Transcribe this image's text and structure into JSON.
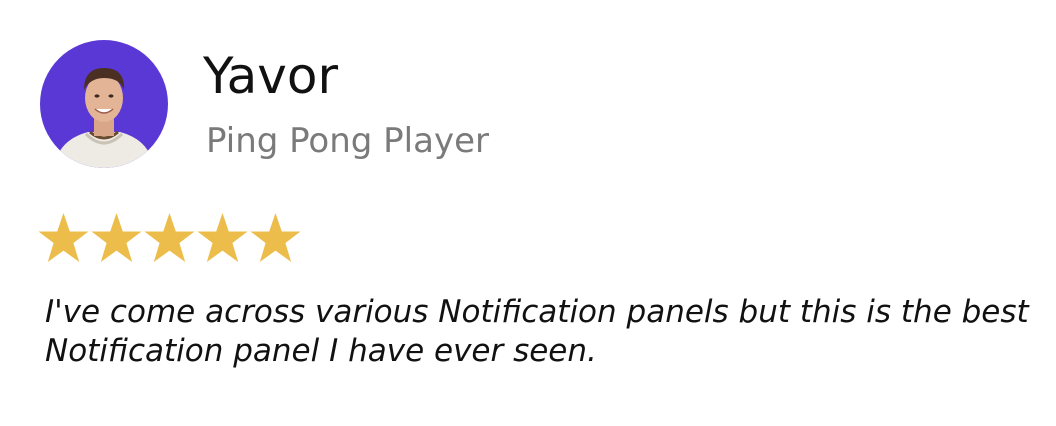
{
  "review_card": {
    "reviewer": {
      "name": "Yavor",
      "title": "Ping Pong Player",
      "avatar_icon": "reviewer-photo",
      "avatar_bg_color": "#5a38d6"
    },
    "rating": {
      "value": 5,
      "max": 5,
      "star_color": "#ecbd4b",
      "star_icon": "star-icon"
    },
    "review_text": "I've come across various Notification panels but this is the best Notification panel I have ever seen."
  }
}
